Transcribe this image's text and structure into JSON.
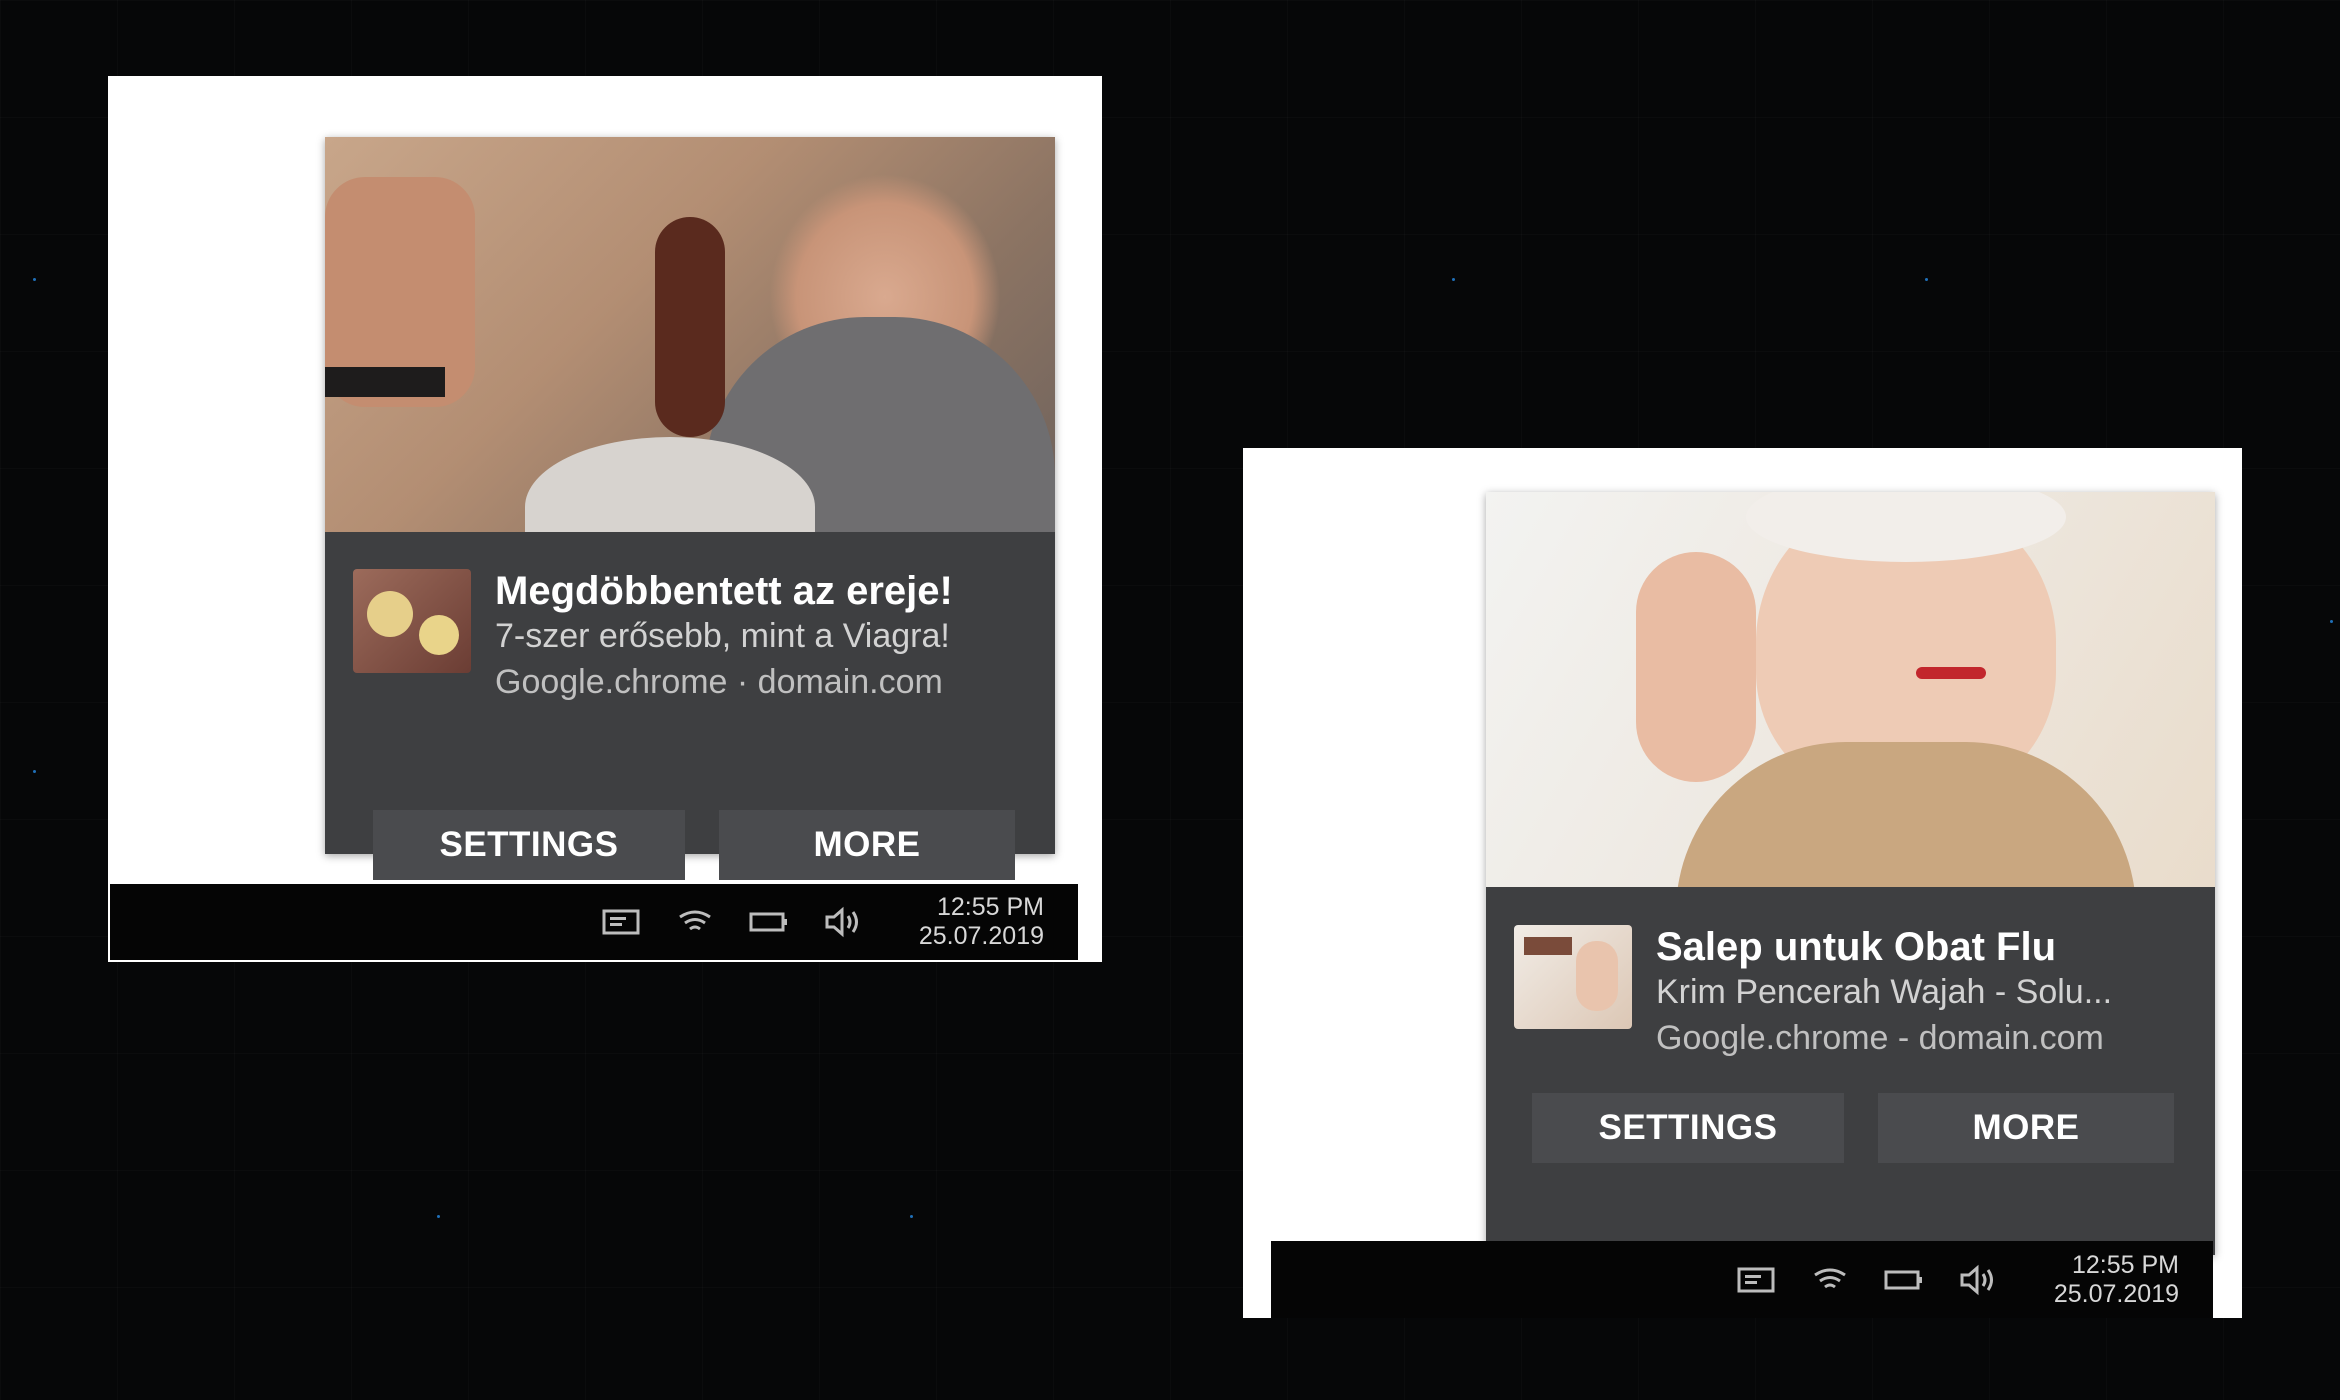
{
  "notifications": [
    {
      "title": "Megdöbbentett az ereje!",
      "subtitle": "7-szer erősebb, mint a Viagra!",
      "source": "Google.chrome · domain.com",
      "settings_label": "SETTINGS",
      "more_label": "MORE",
      "clock_time": "12:55 PM",
      "clock_date": "25.07.2019"
    },
    {
      "title": "Salep untuk Obat Flu",
      "subtitle": "Krim Pencerah Wajah - Solu...",
      "source": "Google.chrome - domain.com",
      "settings_label": "SETTINGS",
      "more_label": "MORE",
      "clock_time": "12:55 PM",
      "clock_date": "25.07.2019"
    }
  ],
  "tray_icons": [
    "notification-center-icon",
    "wifi-icon",
    "battery-icon",
    "volume-icon"
  ],
  "colors": {
    "background": "#060708",
    "notification_bg": "#3e3f41",
    "button_bg": "#4a4b4e",
    "taskbar_bg": "#050505",
    "accent_dots": "#1f6fb8"
  }
}
